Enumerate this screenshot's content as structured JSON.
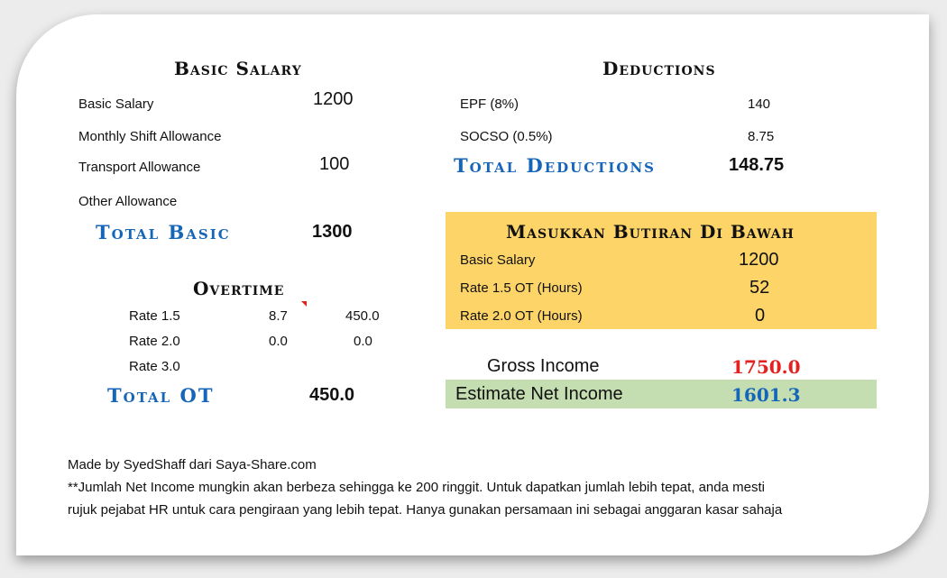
{
  "basic": {
    "title": "Basic Salary",
    "rows": [
      {
        "label": "Basic Salary",
        "value": "1200"
      },
      {
        "label": "Monthly Shift Allowance",
        "value": ""
      },
      {
        "label": "Transport Allowance",
        "value": "100"
      },
      {
        "label": "Other Allowance",
        "value": ""
      }
    ],
    "total_label": "Total Basic",
    "total_value": "1300"
  },
  "overtime": {
    "title": "Overtime",
    "rows": [
      {
        "label": "Rate 1.5",
        "hours": "8.7",
        "amount": "450.0"
      },
      {
        "label": "Rate 2.0",
        "hours": "0.0",
        "amount": "0.0"
      },
      {
        "label": "Rate 3.0",
        "hours": "",
        "amount": ""
      }
    ],
    "total_label": "Total OT",
    "total_value": "450.0"
  },
  "deductions": {
    "title": "Deductions",
    "rows": [
      {
        "label": "EPF (8%)",
        "value": "140"
      },
      {
        "label": "SOCSO (0.5%)",
        "value": "8.75"
      }
    ],
    "total_label": "Total Deductions",
    "total_value": "148.75"
  },
  "input": {
    "title": "Masukkan Butiran Di Bawah",
    "rows": [
      {
        "label": "Basic Salary",
        "value": "1200"
      },
      {
        "label": "Rate 1.5 OT (Hours)",
        "value": "52"
      },
      {
        "label": "Rate 2.0 OT (Hours)",
        "value": "0"
      }
    ]
  },
  "summary": {
    "gross_label": "Gross Income",
    "gross_value": "1750.0",
    "net_label": "Estimate Net Income",
    "net_value": "1601.3"
  },
  "footer": {
    "credit": "Made by SyedShaff dari Saya-Share.com",
    "note_line1": "**Jumlah Net Income mungkin akan berbeza sehingga ke 200 ringgit. Untuk dapatkan jumlah lebih tepat, anda mesti",
    "note_line2": "rujuk pejabat HR untuk cara pengiraan yang lebih tepat. Hanya gunakan persamaan ini sebagai anggaran kasar sahaja"
  },
  "colors": {
    "accent_blue": "#1565b8",
    "gross_red": "#e5211f",
    "input_yellow": "#fcd468",
    "net_green": "#c5deb1"
  }
}
